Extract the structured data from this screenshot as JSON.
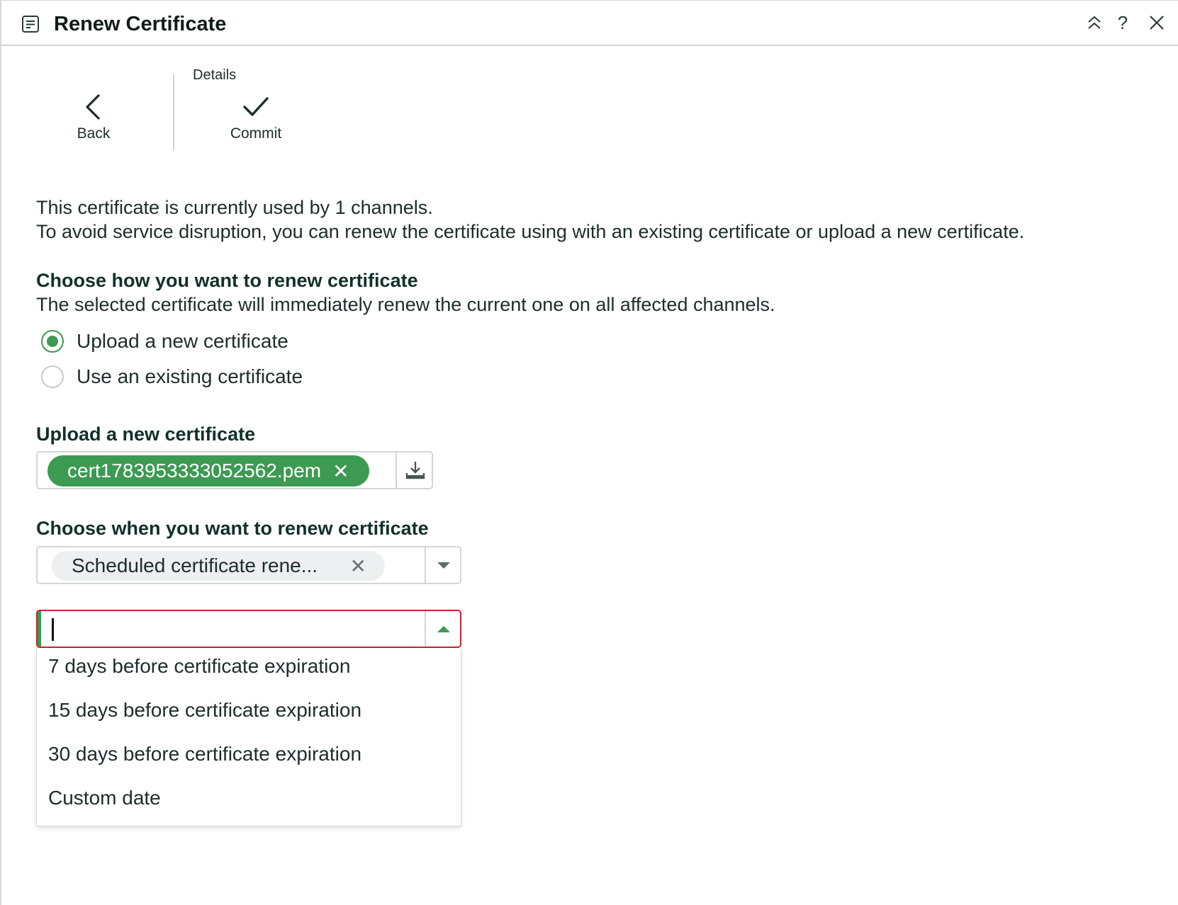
{
  "header": {
    "title": "Renew Certificate",
    "help_label": "?"
  },
  "toolbar": {
    "back_label": "Back",
    "group_label": "Details",
    "commit_label": "Commit"
  },
  "intro": {
    "line1": "This certificate is currently used by 1 channels.",
    "line2": "To avoid service disruption, you can renew the certificate using with an existing certificate or upload a new certificate."
  },
  "renew_method": {
    "heading": "Choose how you want to renew certificate",
    "description": "The selected certificate will immediately renew the current one on all affected channels.",
    "options": [
      {
        "label": "Upload a new certificate",
        "checked": true
      },
      {
        "label": "Use an existing certificate",
        "checked": false
      }
    ]
  },
  "upload": {
    "heading": "Upload a new certificate",
    "file_name": "cert1783953333052562.pem",
    "remove_symbol": "✕"
  },
  "schedule": {
    "heading": "Choose when you want to renew certificate",
    "selected": "Scheduled certificate rene...",
    "remove_symbol": "✕"
  },
  "timing": {
    "input_value": "",
    "options": [
      "7 days before certificate expiration",
      "15 days before certificate expiration",
      "30 days before certificate expiration",
      "Custom date"
    ]
  },
  "colors": {
    "accent_green": "#3c9a52",
    "error_red": "#c0272d",
    "text": "#1d2d2a"
  }
}
